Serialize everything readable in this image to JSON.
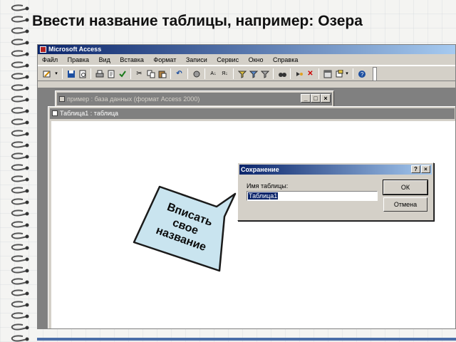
{
  "slide_title": "Ввести название таблицы, например: Озера",
  "app": {
    "title": "Microsoft Access"
  },
  "menu": [
    "Файл",
    "Правка",
    "Вид",
    "Вставка",
    "Формат",
    "Записи",
    "Сервис",
    "Окно",
    "Справка"
  ],
  "toolbar_icons": [
    "design-view-icon",
    "save-icon",
    "print-preview-icon",
    "print-icon",
    "spell-check-icon",
    "cut-icon",
    "copy-icon",
    "paste-icon",
    "undo-icon",
    "sort-ascending-icon",
    "sort-descending-icon",
    "filter-icon",
    "find-icon",
    "new-record-icon",
    "delete-record-icon",
    "database-window-icon",
    "new-object-icon",
    "help-icon"
  ],
  "db_window": {
    "title": "пример : база данных (формат Access 2000)"
  },
  "table_window": {
    "title": "Таблица1 : таблица"
  },
  "save_dialog": {
    "title": "Сохранение",
    "help_button": "?",
    "close_button": "×",
    "label": "Имя таблицы:",
    "input_value": "Таблица1",
    "ok_label": "ОК",
    "cancel_label": "Отмена"
  },
  "callout": {
    "text_line1": "Вписать",
    "text_line2": "свое",
    "text_line3": "название",
    "fill_color": "#c9e4ef",
    "stroke_color": "#1a1a1a"
  },
  "colors": {
    "title_bar": "#0a246a",
    "window_face": "#d4d0c8",
    "workspace": "#808080"
  }
}
